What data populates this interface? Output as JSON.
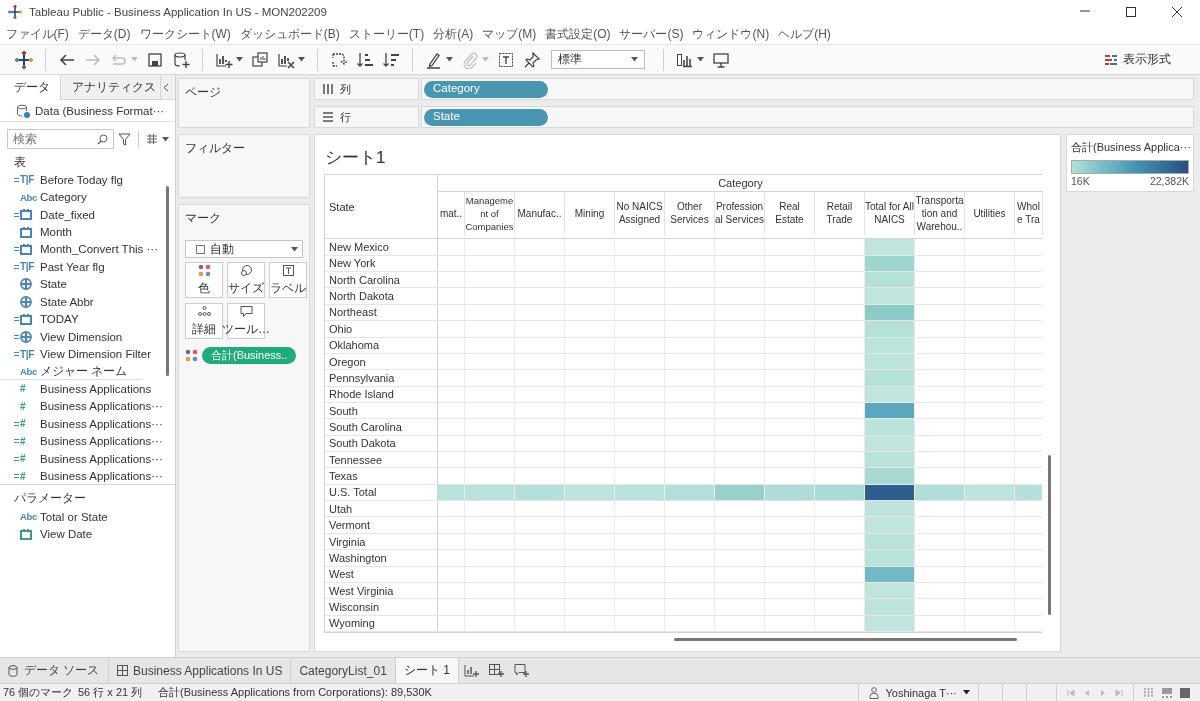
{
  "window": {
    "title": "Tableau Public - Business Application In US - MON202209"
  },
  "menu": [
    "ファイル(F)",
    "データ(D)",
    "ワークシート(W)",
    "ダッシュボード(B)",
    "ストーリー(T)",
    "分析(A)",
    "マップ(M)",
    "書式設定(O)",
    "サーバー(S)",
    "ウィンドウ(N)",
    "ヘルプ(H)"
  ],
  "toolbar": {
    "items": [
      {
        "kind": "logo"
      },
      {
        "kind": "separator"
      },
      {
        "kind": "back",
        "disabled": false,
        "dropdown": false
      },
      {
        "kind": "forward",
        "disabled": true,
        "dropdown": false
      },
      {
        "kind": "redo",
        "disabled": true,
        "dropdown": true
      },
      {
        "kind": "save",
        "disabled": false,
        "dropdown": false
      },
      {
        "kind": "datasource",
        "disabled": false,
        "dropdown": false
      },
      {
        "kind": "separator"
      },
      {
        "kind": "newsheet",
        "disabled": false,
        "dropdown": true
      },
      {
        "kind": "duplicate",
        "disabled": false,
        "dropdown": false
      },
      {
        "kind": "clear",
        "disabled": false,
        "dropdown": true
      },
      {
        "kind": "separator"
      },
      {
        "kind": "swap",
        "disabled": false,
        "dropdown": false
      },
      {
        "kind": "sortasc",
        "disabled": false,
        "dropdown": false
      },
      {
        "kind": "sortdesc",
        "disabled": false,
        "dropdown": false
      },
      {
        "kind": "separator"
      },
      {
        "kind": "highlight",
        "disabled": false,
        "dropdown": true
      },
      {
        "kind": "clip",
        "disabled": true,
        "dropdown": true
      },
      {
        "kind": "textlabel",
        "disabled": false,
        "dropdown": false
      },
      {
        "kind": "pin",
        "disabled": false,
        "dropdown": false
      },
      {
        "kind": "fit",
        "disabled": false,
        "dropdown": true
      },
      {
        "kind": "separator"
      },
      {
        "kind": "chart",
        "disabled": false,
        "dropdown": true
      },
      {
        "kind": "present",
        "disabled": false,
        "dropdown": false
      }
    ],
    "fit": "標準",
    "show_me": "表示形式"
  },
  "data_pane": {
    "tabs": [
      {
        "label": "データ",
        "selected": true
      },
      {
        "label": "アナリティクス",
        "selected": false
      }
    ],
    "datasource": "Data (Business Format···",
    "search": {
      "placeholder": "検索"
    },
    "section": "表",
    "fields": [
      {
        "name": "Before Today flg",
        "kind": "boolean",
        "glyph": "T|F",
        "calculated": true,
        "color": "#4a86b4"
      },
      {
        "name": "Category",
        "kind": "text",
        "glyph": "Abc",
        "calculated": false,
        "color": "#4a86b4"
      },
      {
        "name": "Date_fixed",
        "kind": "date",
        "calculated": true,
        "color": "#4a86b4"
      },
      {
        "name": "Month",
        "kind": "date",
        "calculated": false,
        "color": "#4a86b4"
      },
      {
        "name": "Month_Convert This ···",
        "kind": "date",
        "calculated": true,
        "color": "#4a86b4"
      },
      {
        "name": "Past Year flg",
        "kind": "boolean",
        "glyph": "T|F",
        "calculated": true,
        "color": "#4a86b4"
      },
      {
        "name": "State",
        "kind": "geo",
        "calculated": false,
        "color": "#4a86b4"
      },
      {
        "name": "State Abbr",
        "kind": "geo",
        "calculated": false,
        "color": "#4a86b4"
      },
      {
        "name": "TODAY",
        "kind": "date",
        "calculated": true,
        "color": "#4a86b4"
      },
      {
        "name": "View Dimension",
        "kind": "geo",
        "calculated": true,
        "color": "#4a86b4"
      },
      {
        "name": "View Dimension Filter",
        "kind": "boolean",
        "glyph": "T|F",
        "calculated": true,
        "color": "#4a86b4"
      },
      {
        "name": "メジャー ネーム",
        "kind": "text",
        "glyph": "Abc",
        "calculated": false,
        "color": "#4a86b4"
      },
      {
        "name": "Business Applications",
        "kind": "number",
        "glyph": "#",
        "calculated": false,
        "color": "#3b9e78"
      },
      {
        "name": "Business Applications···",
        "kind": "number",
        "glyph": "#",
        "calculated": false,
        "color": "#3b9e78"
      },
      {
        "name": "Business Applications···",
        "kind": "number",
        "glyph": "#",
        "calculated": true,
        "color": "#3b9e78"
      },
      {
        "name": "Business Applications···",
        "kind": "number",
        "glyph": "#",
        "calculated": true,
        "color": "#3b9e78"
      },
      {
        "name": "Business Applications···",
        "kind": "number",
        "glyph": "#",
        "calculated": true,
        "color": "#3b9e78"
      },
      {
        "name": "Business Applications···",
        "kind": "number",
        "glyph": "#",
        "calculated": true,
        "color": "#3b9e78"
      }
    ],
    "parameters_title": "パラメーター",
    "parameters": [
      {
        "name": "Total or State",
        "kind": "text",
        "glyph": "Abc",
        "calculated": false,
        "color": "#4a86b4"
      },
      {
        "name": "View Date",
        "kind": "date",
        "calculated": false,
        "color": "#3b9e78"
      }
    ]
  },
  "cards": {
    "pages": "ページ",
    "filters": "フィルター",
    "marks": {
      "title": "マーク",
      "type": "自動",
      "buttons": [
        {
          "kind": "color",
          "label": "色"
        },
        {
          "kind": "size",
          "label": "サイズ"
        },
        {
          "kind": "label",
          "label": "ラベル"
        },
        {
          "kind": "detail",
          "label": "詳細"
        },
        {
          "kind": "tooltip",
          "label": "ツール…"
        }
      ],
      "pills": [
        {
          "kind": "color",
          "label": "合計(Business.."
        }
      ]
    }
  },
  "shelves": [
    {
      "kind": "columns",
      "label": "列",
      "pill": "Category"
    },
    {
      "kind": "rows",
      "label": "行",
      "pill": "State"
    }
  ],
  "viz": {
    "title": "シート1",
    "column_group": "Category",
    "row_header": "State",
    "columns": [
      "mat..",
      "Management of Companies",
      "Manufac..",
      "Mining",
      "No NAICS Assigned",
      "Other Services",
      "Professional Services",
      "Real Estate",
      "Retail Trade",
      "Total for All NAICS",
      "Transportation and Warehou..",
      "Utilities",
      "Whol e Tra"
    ],
    "rows": [
      {
        "state": "New Mexico",
        "cells": [
          null,
          null,
          null,
          null,
          null,
          null,
          null,
          null,
          null,
          {
            "color": "#c0e5dd"
          },
          null,
          null,
          null
        ]
      },
      {
        "state": "New York",
        "cells": [
          null,
          null,
          null,
          null,
          null,
          null,
          null,
          null,
          null,
          {
            "color": "#9fd5cf"
          },
          null,
          null,
          null
        ]
      },
      {
        "state": "North Carolina",
        "cells": [
          null,
          null,
          null,
          null,
          null,
          null,
          null,
          null,
          null,
          {
            "color": "#b6e1d9"
          },
          null,
          null,
          null
        ]
      },
      {
        "state": "North Dakota",
        "cells": [
          null,
          null,
          null,
          null,
          null,
          null,
          null,
          null,
          null,
          {
            "color": "#c0e5dd"
          },
          null,
          null,
          null
        ]
      },
      {
        "state": "Northeast",
        "cells": [
          null,
          null,
          null,
          null,
          null,
          null,
          null,
          null,
          null,
          {
            "color": "#8ccbc6"
          },
          null,
          null,
          null
        ]
      },
      {
        "state": "Ohio",
        "cells": [
          null,
          null,
          null,
          null,
          null,
          null,
          null,
          null,
          null,
          {
            "color": "#b6e1d9"
          },
          null,
          null,
          null
        ]
      },
      {
        "state": "Oklahoma",
        "cells": [
          null,
          null,
          null,
          null,
          null,
          null,
          null,
          null,
          null,
          {
            "color": "#bde4dc"
          },
          null,
          null,
          null
        ]
      },
      {
        "state": "Oregon",
        "cells": [
          null,
          null,
          null,
          null,
          null,
          null,
          null,
          null,
          null,
          {
            "color": "#bde4dc"
          },
          null,
          null,
          null
        ]
      },
      {
        "state": "Pennsylvania",
        "cells": [
          null,
          null,
          null,
          null,
          null,
          null,
          null,
          null,
          null,
          {
            "color": "#b6e1d9"
          },
          null,
          null,
          null
        ]
      },
      {
        "state": "Rhode Island",
        "cells": [
          null,
          null,
          null,
          null,
          null,
          null,
          null,
          null,
          null,
          {
            "color": "#c0e5dd"
          },
          null,
          null,
          null
        ]
      },
      {
        "state": "South",
        "cells": [
          null,
          null,
          null,
          null,
          null,
          null,
          null,
          null,
          null,
          {
            "color": "#5ba7bd"
          },
          null,
          null,
          null
        ]
      },
      {
        "state": "South Carolina",
        "cells": [
          null,
          null,
          null,
          null,
          null,
          null,
          null,
          null,
          null,
          {
            "color": "#bae3db"
          },
          null,
          null,
          null
        ]
      },
      {
        "state": "South Dakota",
        "cells": [
          null,
          null,
          null,
          null,
          null,
          null,
          null,
          null,
          null,
          {
            "color": "#c0e5dd"
          },
          null,
          null,
          null
        ]
      },
      {
        "state": "Tennessee",
        "cells": [
          null,
          null,
          null,
          null,
          null,
          null,
          null,
          null,
          null,
          {
            "color": "#b9e2da"
          },
          null,
          null,
          null
        ]
      },
      {
        "state": "Texas",
        "cells": [
          null,
          null,
          null,
          null,
          null,
          null,
          null,
          null,
          null,
          {
            "color": "#a7d9d2"
          },
          null,
          null,
          null
        ]
      },
      {
        "state": "U.S. Total",
        "cells": [
          {
            "color": "#b9e2da"
          },
          {
            "color": "#b9e2da"
          },
          {
            "color": "#b5e0d9"
          },
          {
            "color": "#bde4dc"
          },
          {
            "color": "#b9e2da"
          },
          {
            "color": "#b2dfd7"
          },
          {
            "color": "#98d1cc"
          },
          {
            "color": "#afddd6"
          },
          {
            "color": "#a9dad4"
          },
          {
            "color": "#2e5d8f"
          },
          {
            "color": "#b1ded6"
          },
          {
            "color": "#bde4dc"
          },
          {
            "color": "#b5e0d9"
          }
        ]
      },
      {
        "state": "Utah",
        "cells": [
          null,
          null,
          null,
          null,
          null,
          null,
          null,
          null,
          null,
          {
            "color": "#bde4dc"
          },
          null,
          null,
          null
        ]
      },
      {
        "state": "Vermont",
        "cells": [
          null,
          null,
          null,
          null,
          null,
          null,
          null,
          null,
          null,
          {
            "color": "#c0e5dd"
          },
          null,
          null,
          null
        ]
      },
      {
        "state": "Virginia",
        "cells": [
          null,
          null,
          null,
          null,
          null,
          null,
          null,
          null,
          null,
          {
            "color": "#b9e2da"
          },
          null,
          null,
          null
        ]
      },
      {
        "state": "Washington",
        "cells": [
          null,
          null,
          null,
          null,
          null,
          null,
          null,
          null,
          null,
          {
            "color": "#b9e2da"
          },
          null,
          null,
          null
        ]
      },
      {
        "state": "West",
        "cells": [
          null,
          null,
          null,
          null,
          null,
          null,
          null,
          null,
          null,
          {
            "color": "#72b9c5"
          },
          null,
          null,
          null
        ]
      },
      {
        "state": "West Virginia",
        "cells": [
          null,
          null,
          null,
          null,
          null,
          null,
          null,
          null,
          null,
          {
            "color": "#c0e5dd"
          },
          null,
          null,
          null
        ]
      },
      {
        "state": "Wisconsin",
        "cells": [
          null,
          null,
          null,
          null,
          null,
          null,
          null,
          null,
          null,
          {
            "color": "#bde4dc"
          },
          null,
          null,
          null
        ]
      },
      {
        "state": "Wyoming",
        "cells": [
          null,
          null,
          null,
          null,
          null,
          null,
          null,
          null,
          null,
          {
            "color": "#c0e5dd"
          },
          null,
          null,
          null
        ]
      }
    ]
  },
  "legend": {
    "title": "合計(Business Applica···",
    "min": "16K",
    "max": "22,382K"
  },
  "sheet_tabs": [
    {
      "kind": "datasource",
      "label": "データ ソース",
      "selected": false
    },
    {
      "kind": "dashboard",
      "label": "Business Applications In US",
      "selected": false
    },
    {
      "kind": "sheet",
      "label": "CategoryList_01",
      "selected": false
    },
    {
      "kind": "sheet",
      "label": "シート 1",
      "selected": true
    }
  ],
  "status_bar": {
    "marks": "76 個のマーク",
    "size": "56 行 x 21 列",
    "sum": "合計(Business Applications from Corporations): 89,530K",
    "user": "Yoshinaga T···"
  }
}
